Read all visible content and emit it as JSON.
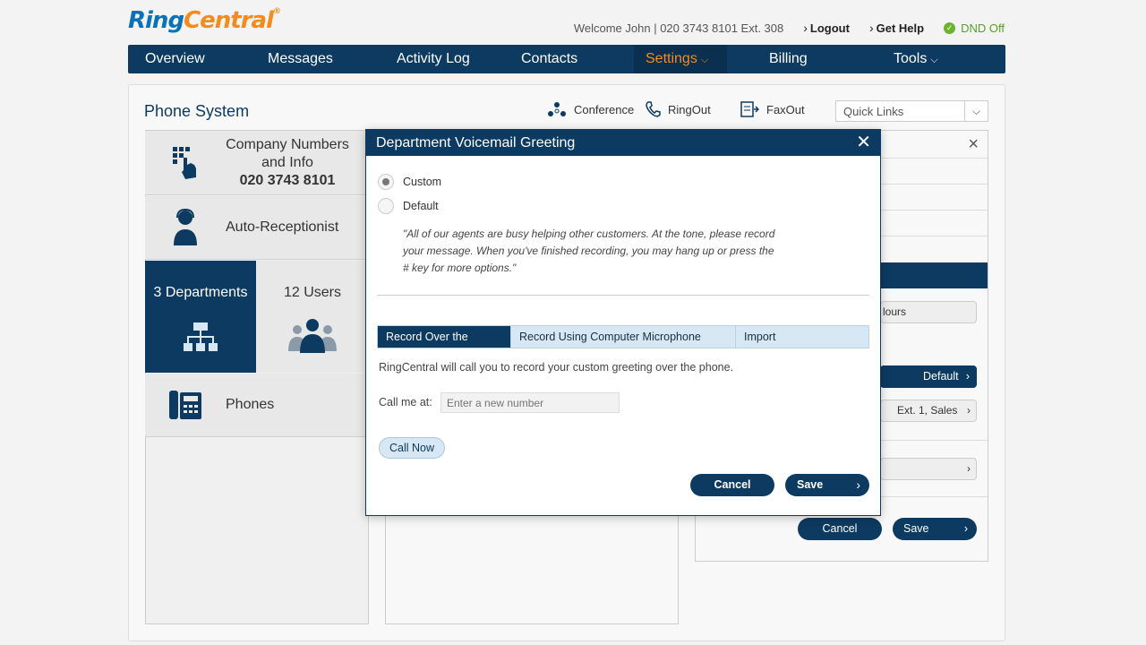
{
  "header": {
    "logo_ring": "Ring",
    "logo_central": "Central",
    "logo_reg": "®",
    "welcome": "Welcome John | 020 3743 8101 Ext. 308",
    "logout": "Logout",
    "get_help": "Get Help",
    "dnd": "DND Off"
  },
  "nav": {
    "items": [
      "Overview",
      "Messages",
      "Activity Log",
      "Contacts",
      "Settings",
      "Billing",
      "Tools"
    ],
    "active": "Settings"
  },
  "page": {
    "title": "Phone System",
    "toolbar": {
      "conference": "Conference",
      "ringout": "RingOut",
      "faxout": "FaxOut",
      "quick_links": "Quick Links"
    },
    "tiles": {
      "company_line1": "Company Numbers",
      "company_line2": "and Info",
      "company_number": "020 3743 8101",
      "auto_receptionist": "Auto-Receptionist",
      "departments": "3 Departments",
      "users": "12 Users",
      "phones": "Phones"
    },
    "right_panel": {
      "hours_fragment": "lours",
      "default_label": "Default",
      "ext_label": "Ext. 1, Sales",
      "cancel": "Cancel",
      "save": "Save"
    }
  },
  "modal": {
    "title": "Department Voicemail Greeting",
    "options": [
      "Custom",
      "Default"
    ],
    "selected": "Custom",
    "quote": "\"All of our agents are busy helping other customers. At the tone, please record your message. When you've finished recording, you may hang up or press the # key for more options.\"",
    "tabs": [
      "Record Over the Phone",
      "Record Using Computer Microphone",
      "Import"
    ],
    "active_tab": "Record Over the Phone",
    "description": "RingCentral will call you to record your custom greeting over the phone.",
    "call_me_label": "Call me at:",
    "call_me_placeholder": "Enter a new number",
    "call_now": "Call Now",
    "cancel": "Cancel",
    "save": "Save"
  },
  "colors": {
    "navy": "#0d3a60",
    "orange": "#f28c1e",
    "light_blue": "#d7e7f4",
    "dnd_green": "#69b32e"
  }
}
